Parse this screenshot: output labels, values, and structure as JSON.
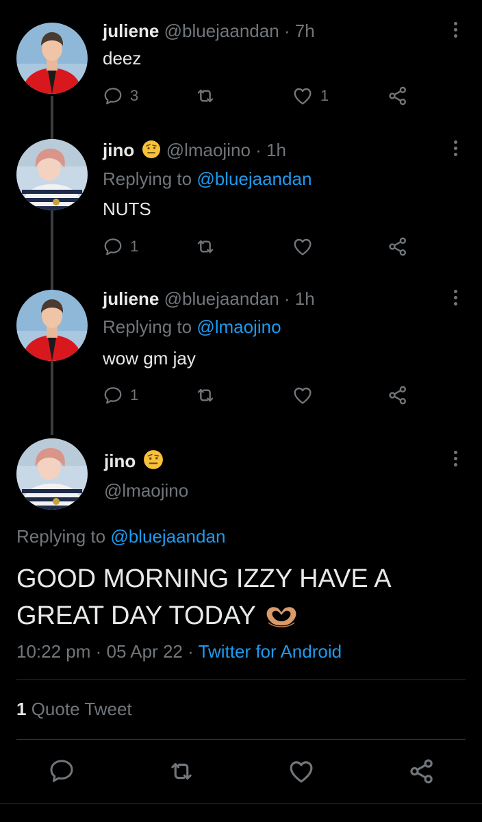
{
  "tweets": [
    {
      "name": "juliene",
      "handle": "@bluejaandan",
      "time": "· 7h",
      "replying_label": "",
      "replying_to": "",
      "text": "deez",
      "replies": "3",
      "retweets": "",
      "likes": "1"
    },
    {
      "name": "jino",
      "handle": "@lmaojino",
      "time": "· 1h",
      "replying_label": "Replying to",
      "replying_to": "@bluejaandan",
      "text": "NUTS",
      "replies": "1",
      "retweets": "",
      "likes": ""
    },
    {
      "name": "juliene",
      "handle": "@bluejaandan",
      "time": "· 1h",
      "replying_label": "Replying to",
      "replying_to": "@lmaojino",
      "text": "wow gm jay",
      "replies": "1",
      "retweets": "",
      "likes": ""
    }
  ],
  "main": {
    "name": "jino",
    "handle": "@lmaojino",
    "replying_label": "Replying to",
    "replying_to": "@bluejaandan",
    "text_line1": "GOOD MORNING IZZY HAVE A",
    "text_line2": "GREAT DAY TODAY",
    "time": "10:22 pm",
    "date": "05 Apr 22",
    "source": "Twitter for Android",
    "sep": "·",
    "quote_count": "1",
    "quote_label": "Quote Tweet"
  },
  "icons": {
    "reply": "reply-icon",
    "retweet": "retweet-icon",
    "like": "heart-icon",
    "share": "share-icon",
    "more": "more-vertical-icon"
  },
  "colors": {
    "background": "#000000",
    "text": "#e7e9ea",
    "muted": "#71767b",
    "link": "#1d9bf0"
  }
}
